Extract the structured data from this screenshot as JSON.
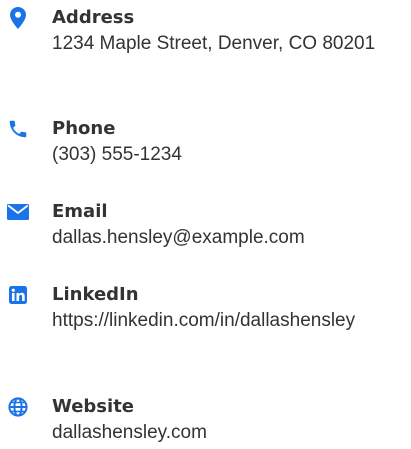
{
  "accent_color": "#1a73e8",
  "text_color": "#333333",
  "contacts": [
    {
      "icon": "map-pin-icon",
      "label": "Address",
      "value": "1234 Maple Street, Denver, CO 80201"
    },
    {
      "icon": "phone-icon",
      "label": "Phone",
      "value": "(303) 555-1234"
    },
    {
      "icon": "envelope-icon",
      "label": "Email",
      "value": "dallas.hensley@example.com"
    },
    {
      "icon": "linkedin-icon",
      "label": "LinkedIn",
      "value": "https://linkedin.com/in/dallashensley"
    },
    {
      "icon": "globe-icon",
      "label": "Website",
      "value": "dallashensley.com"
    }
  ]
}
